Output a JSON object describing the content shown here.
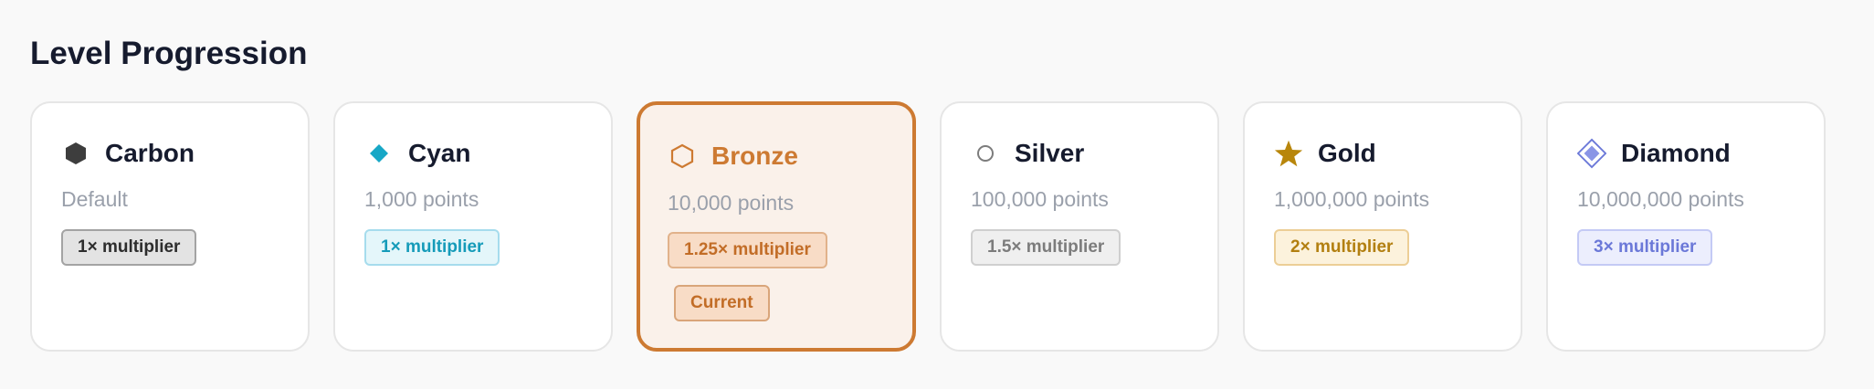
{
  "page": {
    "title": "Level Progression"
  },
  "tiers": [
    {
      "name": "Carbon",
      "sub": "Default",
      "multiplier": "1× multiplier",
      "icon": "hexagon-filled-icon",
      "badge_bg": "#e3e3e3",
      "badge_border": "#a3a3a3",
      "badge_text": "#2d2d2d"
    },
    {
      "name": "Cyan",
      "sub": "1,000 points",
      "multiplier": "1× multiplier",
      "icon": "diamond-filled-icon",
      "badge_bg": "#e4f6fa",
      "badge_border": "#a6dced",
      "badge_text": "#159bb9"
    },
    {
      "name": "Bronze",
      "sub": "10,000 points",
      "multiplier": "1.25× multiplier",
      "icon": "hexagon-outline-icon",
      "current": true,
      "current_label": "Current",
      "badge_bg": "#f8dcc6",
      "badge_border": "#e1b28a",
      "badge_text": "#c26d27"
    },
    {
      "name": "Silver",
      "sub": "100,000 points",
      "multiplier": "1.5× multiplier",
      "icon": "circle-outline-icon",
      "badge_bg": "#efefef",
      "badge_border": "#cfcfcf",
      "badge_text": "#7c7c7c"
    },
    {
      "name": "Gold",
      "sub": "1,000,000 points",
      "multiplier": "2× multiplier",
      "icon": "star-icon",
      "badge_bg": "#fcf2dc",
      "badge_border": "#ecce96",
      "badge_text": "#b27f10"
    },
    {
      "name": "Diamond",
      "sub": "10,000,000 points",
      "multiplier": "3× multiplier",
      "icon": "diamond-outline-icon",
      "badge_bg": "#eceefd",
      "badge_border": "#c4caf5",
      "badge_text": "#6b78d8"
    }
  ],
  "colors": {
    "bronze_accent": "#cd7a32",
    "carbon_icon": "#3d3d3d",
    "cyan_icon": "#17a7c6",
    "silver_icon": "#7c7c7c",
    "gold_icon": "#b8860b",
    "diamond_icon": "#6b78d8"
  }
}
